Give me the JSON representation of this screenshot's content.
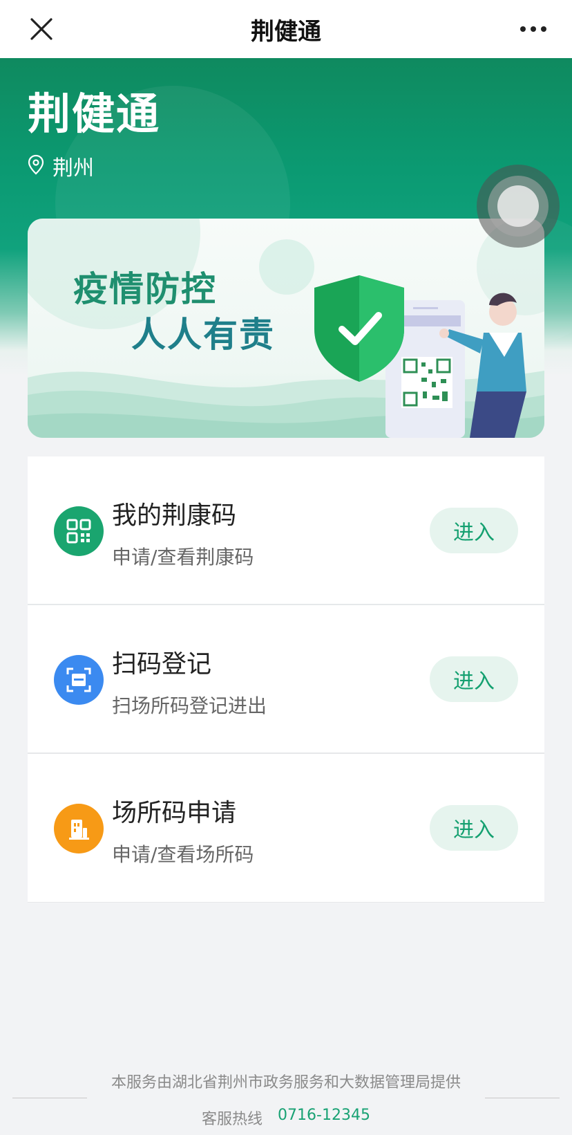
{
  "navbar": {
    "title": "荆健通",
    "close_icon": "close-icon",
    "more_icon": "more-icon"
  },
  "header": {
    "title": "荆健通",
    "location": "荆州",
    "location_icon": "location-pin-icon"
  },
  "banner": {
    "line1": "疫情防控",
    "line2": "人人有责"
  },
  "cards": [
    {
      "title": "我的荆康码",
      "subtitle": "申请/查看荆康码",
      "button": "进入",
      "icon": "qr-code-icon",
      "icon_color": "#1aa56f"
    },
    {
      "title": "扫码登记",
      "subtitle": "扫场所码登记进出",
      "button": "进入",
      "icon": "scan-icon",
      "icon_color": "#3b8af0"
    },
    {
      "title": "场所码申请",
      "subtitle": "申请/查看场所码",
      "button": "进入",
      "icon": "venue-icon",
      "icon_color": "#f79a16"
    }
  ],
  "footer": {
    "provider": "本服务由湖北省荆州市政务服务和大数据管理局提供",
    "hotline_label": "客服热线",
    "hotline_number": "0716-12345"
  },
  "colors": {
    "brand_green": "#0f8a5f",
    "button_text": "#14a070",
    "button_bg": "#e6f4ee"
  }
}
